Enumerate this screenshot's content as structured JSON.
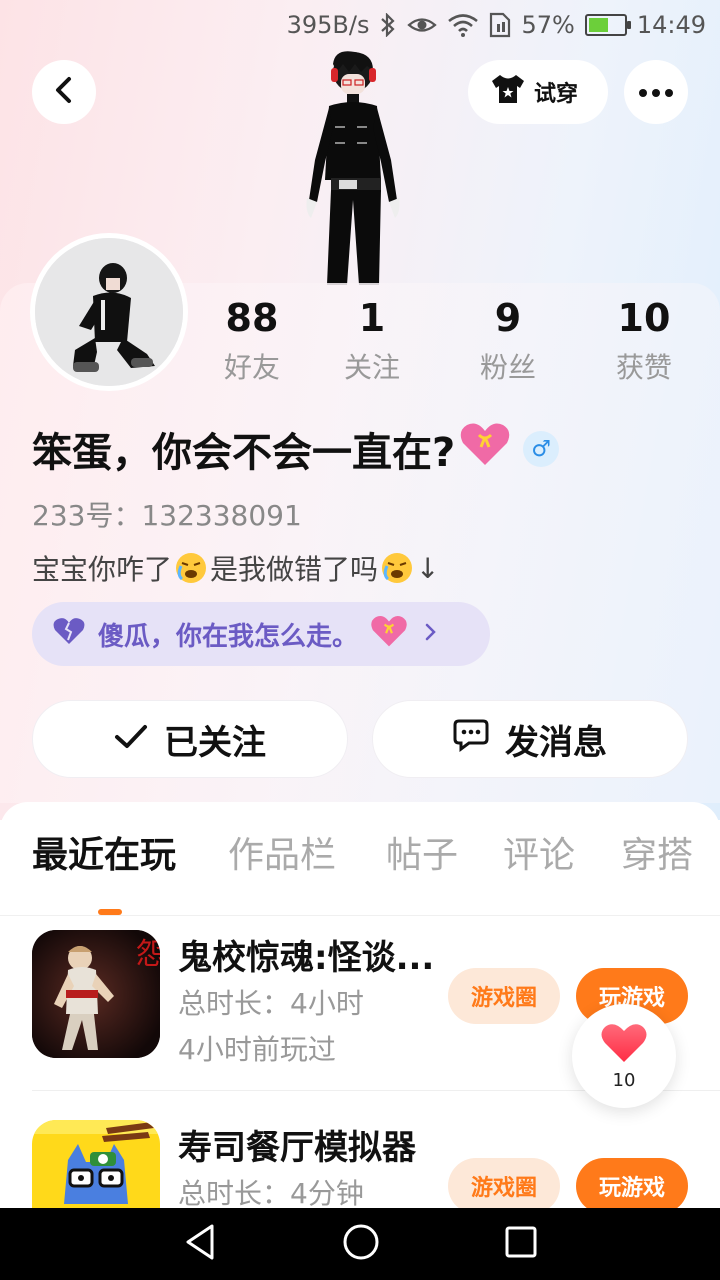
{
  "status_bar": {
    "net_speed": "395B/s",
    "battery_percent": "57%",
    "battery_level": 0.57,
    "time": "14:49"
  },
  "header": {
    "back_icon": "chevron-left-icon",
    "try_on_label": "试穿",
    "more_icon": "more-dots-icon"
  },
  "stats": [
    {
      "value": "88",
      "label": "好友"
    },
    {
      "value": "1",
      "label": "关注"
    },
    {
      "value": "9",
      "label": "粉丝"
    },
    {
      "value": "10",
      "label": "获赞"
    }
  ],
  "profile": {
    "nickname": "笨蛋，你会不会一直在?",
    "gender_symbol": "♂",
    "account_id": "233号：132338091",
    "bio_part1": "宝宝你咋了",
    "bio_part2": "是我做错了吗",
    "bio_part3": "↓",
    "status_text": "傻瓜，你在我怎么走。"
  },
  "actions": {
    "follow_label": "已关注",
    "message_label": "发消息"
  },
  "tabs": [
    {
      "label": "最近在玩",
      "active": true
    },
    {
      "label": "作品栏",
      "active": false
    },
    {
      "label": "帖子",
      "active": false
    },
    {
      "label": "评论",
      "active": false
    },
    {
      "label": "穿搭",
      "active": false
    }
  ],
  "games": [
    {
      "title": "鬼校惊魂:怪谈...",
      "duration": "总时长：4小时",
      "last_played": "4小时前玩过",
      "circle_label": "游戏圈",
      "play_label": "玩游戏"
    },
    {
      "title": "寿司餐厅模拟器",
      "duration": "总时长：4分钟",
      "last_played": "",
      "circle_label": "游戏圈",
      "play_label": "玩游戏"
    }
  ],
  "like_fab": {
    "count": "10"
  },
  "colors": {
    "accent": "#ff7a1a",
    "chip_bg": "#fde8d8",
    "status_chip_text": "#6b5bc4",
    "heart": "#ff3b4f"
  }
}
